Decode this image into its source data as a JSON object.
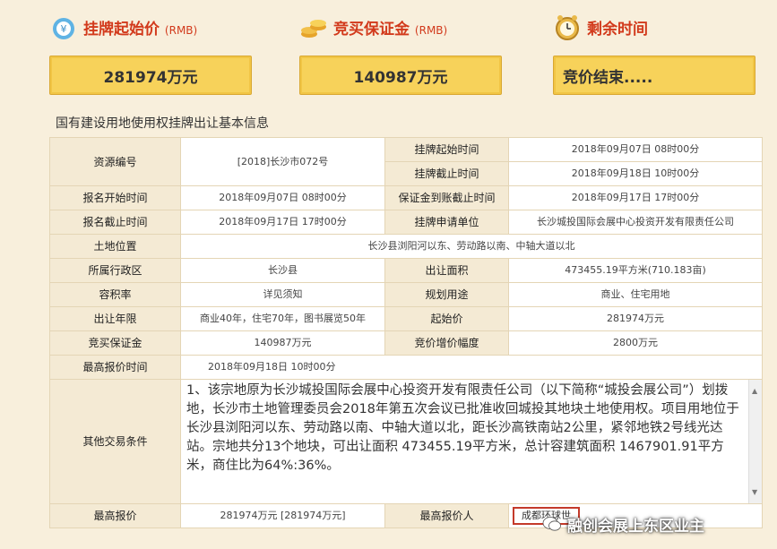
{
  "header": {
    "start_price": {
      "label": "挂牌起始价",
      "unit": "(RMB)",
      "value": "281974万元"
    },
    "deposit": {
      "label": "竞买保证金",
      "unit": "(RMB)",
      "value": "140987万元"
    },
    "remaining": {
      "label": "剩余时间",
      "value": "竞价结束....."
    }
  },
  "section_title": "国有建设用地使用权挂牌出让基本信息",
  "table": {
    "resource_no_label": "资源编号",
    "resource_no": "[2018]长沙市072号",
    "list_start_label": "挂牌起始时间",
    "list_start": "2018年09月07日 08时00分",
    "list_end_label": "挂牌截止时间",
    "list_end": "2018年09月18日 10时00分",
    "reg_start_label": "报名开始时间",
    "reg_start": "2018年09月07日 08时00分",
    "deposit_deadline_label": "保证金到账截止时间",
    "deposit_deadline": "2018年09月17日 17时00分",
    "reg_end_label": "报名截止时间",
    "reg_end": "2018年09月17日 17时00分",
    "applicant_label": "挂牌申请单位",
    "applicant": "长沙城投国际会展中心投资开发有限责任公司",
    "location_label": "土地位置",
    "location": "长沙县浏阳河以东、劳动路以南、中轴大道以北",
    "district_label": "所属行政区",
    "district": "长沙县",
    "area_label": "出让面积",
    "area": "473455.19平方米(710.183亩)",
    "far_label": "容积率",
    "far": "详见须知",
    "use_label": "规划用途",
    "use": "商业、住宅用地",
    "term_label": "出让年限",
    "term": "商业40年，住宅70年，图书展览50年",
    "start_price_label": "起始价",
    "start_price": "281974万元",
    "deposit_label": "竞买保证金",
    "deposit": "140987万元",
    "increment_label": "竞价增价幅度",
    "increment": "2800万元",
    "last_bid_time_label": "最高报价时间",
    "last_bid_time": "2018年09月18日 10时00分",
    "conditions_label": "其他交易条件",
    "conditions": "1、该宗地原为长沙城投国际会展中心投资开发有限责任公司（以下简称“城投会展公司”）划拨地，长沙市土地管理委员会2018年第五次会议已批准收回城投其地块土地使用权。项目用地位于长沙县浏阳河以东、劳动路以南、中轴大道以北，距长沙高铁南站2公里，紧邻地铁2号线光达站。宗地共分13个地块，可出让面积 473455.19平方米，总计容建筑面积 1467901.91平方米，商住比为64%:36%。",
    "highest_bid_label": "最高报价",
    "highest_bid": "281974万元 [281974万元]",
    "highest_bidder_label": "最高报价人",
    "highest_bidder": "成都环球世"
  },
  "watermark": "融创会展上东区业主"
}
